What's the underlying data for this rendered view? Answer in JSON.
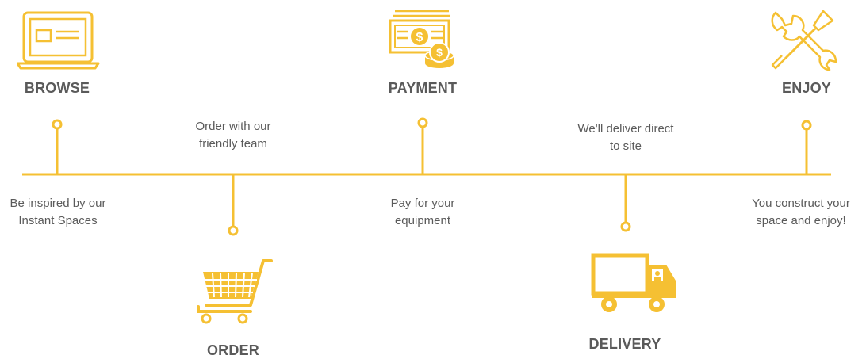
{
  "colors": {
    "accent": "#f5c033",
    "text": "#5a5a5a"
  },
  "steps": [
    {
      "id": "browse",
      "icon": "laptop-icon",
      "title": "BROWSE",
      "description": "Be inspired by our\nInstant Spaces"
    },
    {
      "id": "order",
      "icon": "shopping-cart-icon",
      "title": "ORDER",
      "description": "Order with our\nfriendly team"
    },
    {
      "id": "payment",
      "icon": "money-icon",
      "title": "PAYMENT",
      "description": "Pay for your\nequipment"
    },
    {
      "id": "delivery",
      "icon": "truck-icon",
      "title": "DELIVERY",
      "description": "We'll deliver direct\nto site"
    },
    {
      "id": "enjoy",
      "icon": "tools-icon",
      "title": "ENJOY",
      "description": "You construct your\nspace and enjoy!"
    }
  ]
}
